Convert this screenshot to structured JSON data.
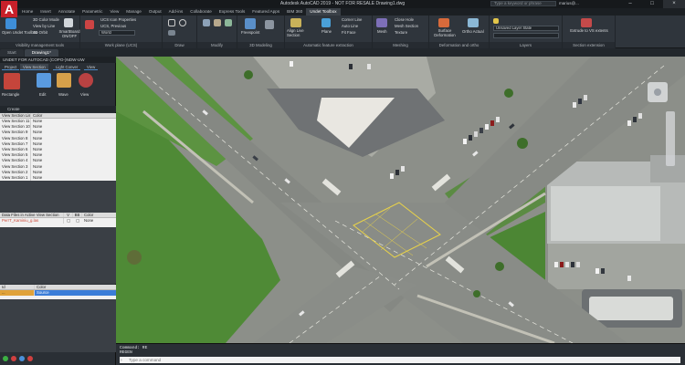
{
  "titlebar": {
    "title": "Autodesk AutoCAD 2019 - NOT FOR RESALE   Drawing1.dwg",
    "search_placeholder": "Type a keyword or phrase",
    "user": "marius@...",
    "app_letter": "A"
  },
  "ribbon_tabs": [
    "Home",
    "Insert",
    "Annotate",
    "Parametric",
    "View",
    "Manage",
    "Output",
    "Add-ins",
    "Collaborate",
    "Express Tools",
    "Featured Apps",
    "BIM 360",
    "Undet Toolbox"
  ],
  "active_tab": "Undet Toolbox",
  "ribbon": {
    "panels": {
      "visibility": "Visibility management tools",
      "workplane": "Work plane (UCS)",
      "draw": "Draw",
      "modify": "Modify",
      "modeling3d": "3D Modeling",
      "automatic": "Automatic feature extraction",
      "meshing": "Meshing",
      "deformation": "Deformation and ortho",
      "layers": "Layers",
      "section": "Section extension"
    },
    "labels": {
      "open_undet": "Open Undet Toolbox",
      "color_mode": "3D Color Mode",
      "view_by_line": "View by Line",
      "orbit": "3D Orbit",
      "smartboard": "SmartBoard ON/OFF",
      "ucs_props": "UCS Icon Properties",
      "ucs_previous": "UCS, Previous",
      "world": "World",
      "freespoint": "Freespoint",
      "align_section": "Align Live Section",
      "plane": "Plane",
      "corner_line": "Corner Line",
      "auto_line": "Auto Line",
      "fit_face": "Fit Face",
      "mesh": "Mesh",
      "close_hole": "Close Hole",
      "mesh_section": "Mesh Section",
      "texture": "Texture",
      "surface_deformation": "Surface Deformation",
      "ortho_actual": "Ortho Actual",
      "layer_state": "Unsaved Layer State",
      "extrude": "Extrude to VS extents"
    }
  },
  "doc_tabs": [
    "Start",
    "Drawing1*"
  ],
  "active_doc": "Drawing1*",
  "palette": {
    "title": "UNDET FOR AUTOCAD (COPO-)NDW-UW",
    "tabs": [
      "Project",
      "View Section",
      "Light Conver",
      "View"
    ],
    "create_label": "Create",
    "tools": [
      "Rectangle",
      "Edit",
      "Wave",
      "View"
    ],
    "sections_header": [
      "View Section List",
      "Color"
    ],
    "sections": [
      [
        "View Section 11",
        "None"
      ],
      [
        "View Section 10",
        "None"
      ],
      [
        "View Section 9",
        "None"
      ],
      [
        "View Section 8",
        "None"
      ],
      [
        "View Section 7",
        "None"
      ],
      [
        "View Section 6",
        "None"
      ],
      [
        "View Section 5",
        "None"
      ],
      [
        "View Section 4",
        "None"
      ],
      [
        "View Section 3",
        "None"
      ],
      [
        "View Section 2",
        "None"
      ],
      [
        "View Section 1",
        "None"
      ]
    ],
    "files_header": [
      "Data Files in Active View Section",
      "V",
      "BB",
      "Color"
    ],
    "files": [
      [
        "PerrT_Kaminiu_g.las",
        "",
        "",
        "None"
      ]
    ],
    "layers_header": [
      "Id",
      "Color"
    ],
    "layers": [
      [
        "...",
        "Source"
      ]
    ]
  },
  "command": {
    "lines": [
      "Command: RE",
      "REGEN"
    ],
    "placeholder": "Type a command"
  },
  "colors": {
    "accent": "#3b7dd8",
    "road": "#8e918c",
    "grass": "#4f8a36",
    "sidewalk": "#b9b8ad"
  }
}
